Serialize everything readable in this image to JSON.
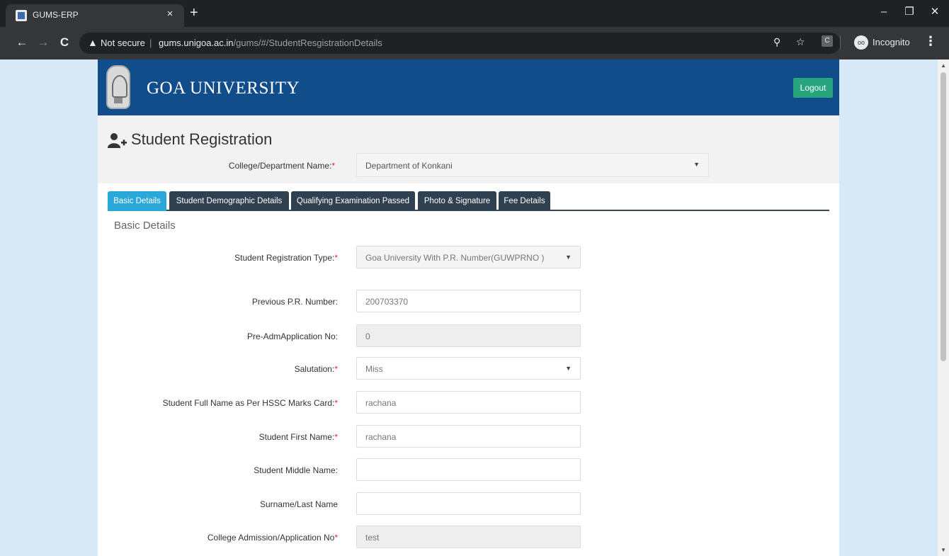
{
  "browser": {
    "tab_title": "GUMS-ERP",
    "tab_close": "×",
    "new_tab": "+",
    "minimize": "–",
    "restore": "❐",
    "close": "✕",
    "back": "←",
    "forward": "→",
    "reload": "C",
    "security_icon": "▲",
    "security_text": "Not secure",
    "omni_separator": "|",
    "url_host": "gums.unigoa.ac.in",
    "url_path": "/gums/#/StudentResgistrationDetails",
    "zoom_icon": "⚲",
    "star_icon": "☆",
    "extension_label": "C",
    "incognito_icon": "oo",
    "incognito_label": "Incognito",
    "menu": "⋮"
  },
  "scrollbar": {
    "up": "▲",
    "down": "▼"
  },
  "header": {
    "brand": "GOA UNIVERSITY",
    "logout_label": "Logout"
  },
  "registration": {
    "title": "Student Registration",
    "college_label": "College/Department Name:",
    "required_mark": "*",
    "college_value": "Department of Konkani",
    "caret": "▼"
  },
  "tabs": [
    {
      "label": "Basic Details",
      "active": true
    },
    {
      "label": "Student Demographic Details",
      "active": false
    },
    {
      "label": "Qualifying Examination Passed",
      "active": false
    },
    {
      "label": "Photo & Signature",
      "active": false
    },
    {
      "label": "Fee Details",
      "active": false
    }
  ],
  "section_title": "Basic Details",
  "fields": [
    {
      "label": "Student Registration Type:",
      "required": "*",
      "value": "Goa University With P.R. Number(GUWPRNO )",
      "kind": "select"
    },
    {
      "label": "Previous P.R. Number:",
      "required": "",
      "value": "200703370",
      "kind": "input"
    },
    {
      "label": "Pre-AdmApplication No:",
      "required": "",
      "value": "0",
      "kind": "readonly"
    },
    {
      "label": "Salutation:",
      "required": "*",
      "value": "Miss",
      "kind": "select-white"
    },
    {
      "label": "Student Full Name as Per HSSC Marks Card:",
      "required": "*",
      "value": "rachana",
      "kind": "input"
    },
    {
      "label": "Student First Name:",
      "required": "*",
      "value": "rachana",
      "kind": "input"
    },
    {
      "label": "Student Middle Name:",
      "required": "",
      "value": "",
      "kind": "input"
    },
    {
      "label": "Surname/Last Name",
      "required": "",
      "value": "",
      "kind": "input"
    },
    {
      "label": "College Admission/Application No",
      "required": "*",
      "value": "test",
      "kind": "readonly"
    }
  ]
}
